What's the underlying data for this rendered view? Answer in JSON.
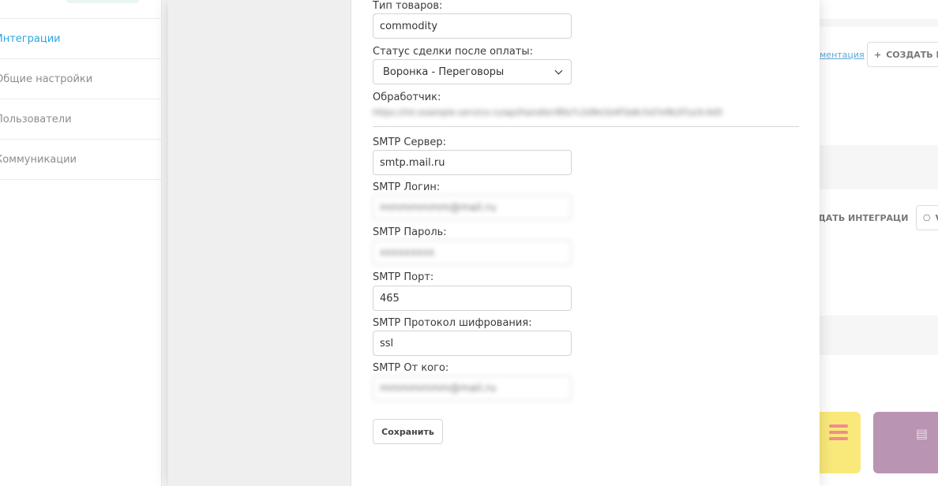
{
  "sidebar": {
    "items": [
      {
        "label": "Интеграции",
        "active": true
      },
      {
        "label": "Общие настройки",
        "active": false
      },
      {
        "label": "Пользователи",
        "active": false
      },
      {
        "label": "Коммуникации",
        "active": false
      }
    ]
  },
  "background": {
    "doc_link": "ментация",
    "create_button": "СОЗДАТЬ ИН",
    "create_integration_button": "ДАТЬ ИНТЕГРАЦИЮ",
    "small_button": "V"
  },
  "form": {
    "goods_type": {
      "label": "Тип товаров:",
      "value": "commodity"
    },
    "deal_status": {
      "label": "Статус сделки после оплаты:",
      "value": "Воронка - Переговоры"
    },
    "handler": {
      "label": "Обработчик:",
      "value": "https://int.example-service.ru/api/handler/8fa7c2d9e1b4f3a6c5d7e9b2f1a3c4d5"
    },
    "smtp_server": {
      "label": "SMTP Сервер:",
      "value": "smtp.mail.ru"
    },
    "smtp_login": {
      "label": "SMTP Логин:",
      "value": "mmmmmmm@mail.ru"
    },
    "smtp_password": {
      "label": "SMTP Пароль:",
      "value": "xxxxxxxxx"
    },
    "smtp_port": {
      "label": "SMTP Порт:",
      "value": "465"
    },
    "smtp_protocol": {
      "label": "SMTP Протокол шифрования:",
      "value": "ssl"
    },
    "smtp_from": {
      "label": "SMTP От кого:",
      "value": "mmmmmmm@mail.ru"
    },
    "save_label": "Сохранить"
  },
  "colors": {
    "accent": "#2aa6e0",
    "yellow_tile": "#f9e97a",
    "purple_tile": "#b995b3"
  }
}
